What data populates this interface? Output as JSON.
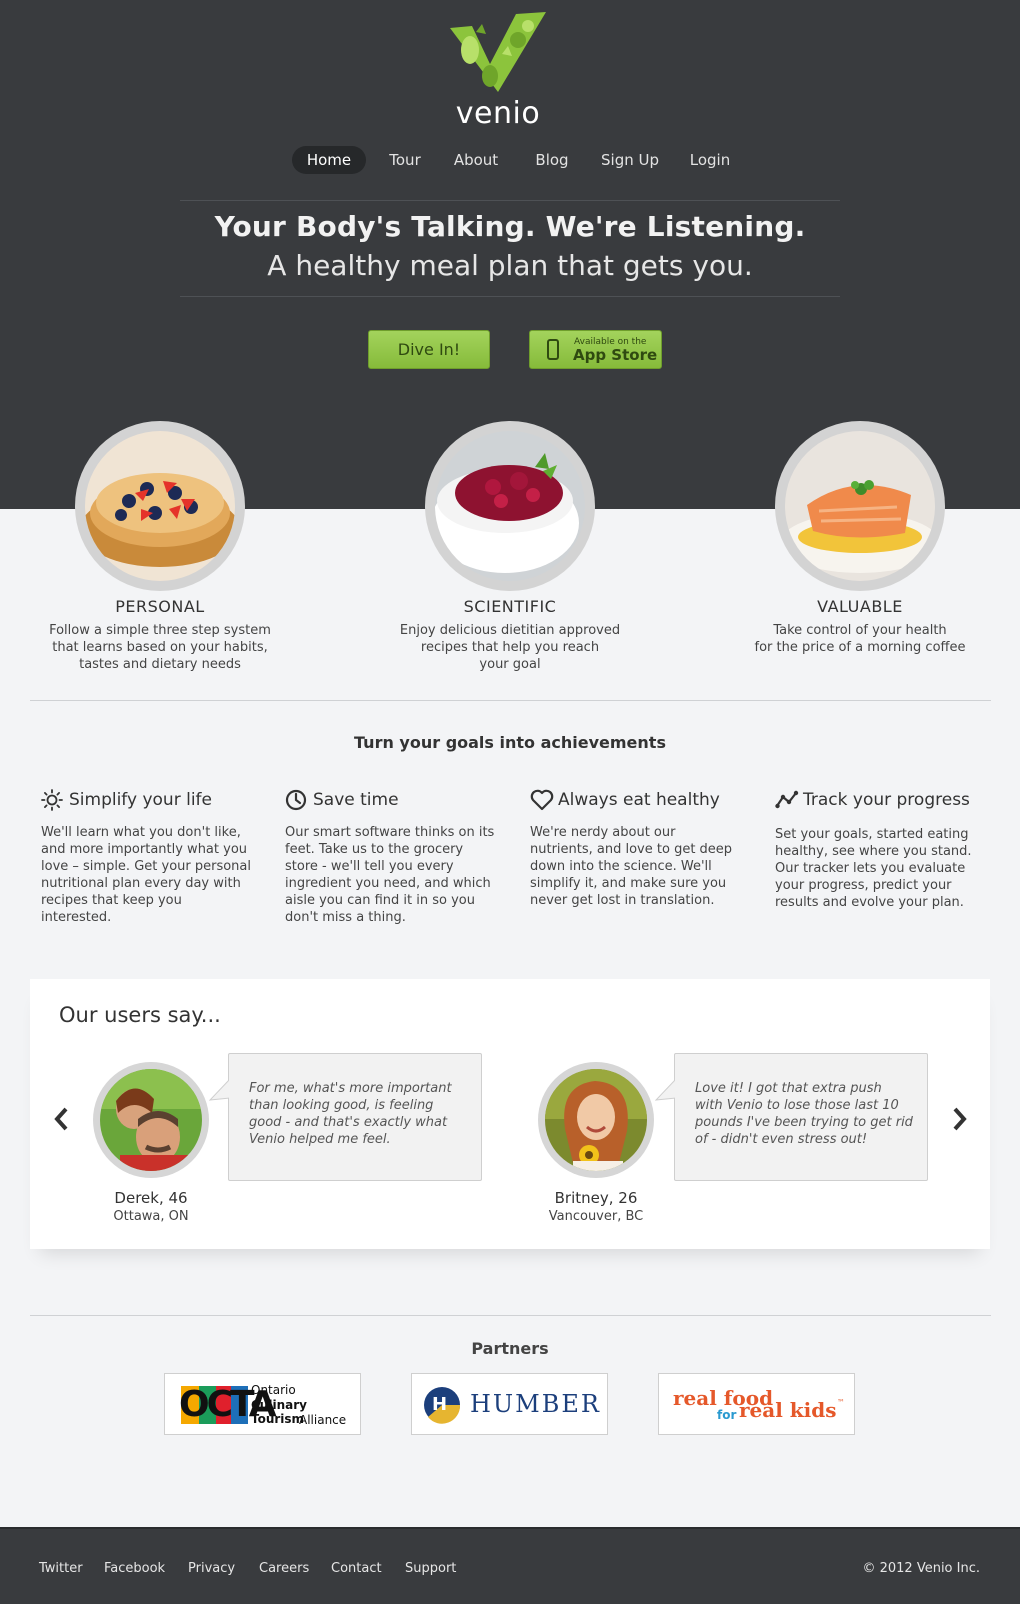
{
  "brand": {
    "name": "venio",
    "accent": "#8cc43c",
    "dark": "#393b3e"
  },
  "nav": {
    "items": [
      {
        "label": "Home",
        "active": true
      },
      {
        "label": "Tour"
      },
      {
        "label": "About"
      },
      {
        "label": "Blog"
      },
      {
        "label": "Sign Up"
      },
      {
        "label": "Login"
      }
    ]
  },
  "hero": {
    "headline": "Your Body's Talking. We're Listening.",
    "subhead": "A healthy meal plan that gets you.",
    "cta_label": "Dive In!",
    "appstore_small": "Available on the",
    "appstore_big": "App Store"
  },
  "features": [
    {
      "title": "PERSONAL",
      "desc": "Follow a simple three step system\nthat learns based on your habits,\ntastes and dietary needs",
      "image": "pancakes-with-berries"
    },
    {
      "title": "SCIENTIFIC",
      "desc": "Enjoy delicious dietitian approved\nrecipes that help you reach\nyour goal",
      "image": "beet-salad-bowl"
    },
    {
      "title": "VALUABLE",
      "desc": "Take control of your health\nfor the price of a morning coffee",
      "image": "salmon-fillet-plate"
    }
  ],
  "goals": {
    "title": "Turn your goals into achievements",
    "items": [
      {
        "icon": "sun-icon",
        "title": "Simplify your life",
        "text": "We'll learn what you don't like, and more importantly what you love – simple. Get your personal nutritional plan every day with recipes that keep you interested."
      },
      {
        "icon": "clock-icon",
        "title": "Save time",
        "text": "Our smart software thinks on its feet. Take us to the grocery store - we'll tell you every ingredient you need, and which aisle you can find it in so you don't miss a thing."
      },
      {
        "icon": "heart-icon",
        "title": "Always eat healthy",
        "text": "We're nerdy about our nutrients, and love to get deep down into the science. We'll simplify it, and make sure you never get lost in translation."
      },
      {
        "icon": "graph-icon",
        "title": "Track your progress",
        "text": "Set your goals, started eating healthy, see where you stand. Our tracker lets you evaluate your progress, predict your results and evolve your plan."
      }
    ]
  },
  "testimonials": {
    "title": "Our users say...",
    "items": [
      {
        "name": "Derek, 46",
        "place": "Ottawa, ON",
        "quote": "For me, what's more important than looking good, is feeling good - and that's exactly what Venio helped me feel."
      },
      {
        "name": "Britney, 26",
        "place": "Vancouver, BC",
        "quote": "Love it! I got that extra push with Venio to lose those last 10 pounds I've been trying to get rid of - didn't even stress out!"
      }
    ]
  },
  "partners": {
    "title": "Partners",
    "items": [
      {
        "mark": "OCTA",
        "line1": "Ontario",
        "line2": "Culinary Tourism",
        "line3": "Alliance"
      },
      {
        "mark": "H",
        "name": "HUMBER"
      },
      {
        "line1": "real food",
        "line2": "for",
        "line3": "real kids",
        "tm": "™"
      }
    ]
  },
  "footer": {
    "links": [
      "Twitter",
      "Facebook",
      "Privacy",
      "Careers",
      "Contact",
      "Support"
    ],
    "copyright": "© 2012 Venio Inc."
  }
}
